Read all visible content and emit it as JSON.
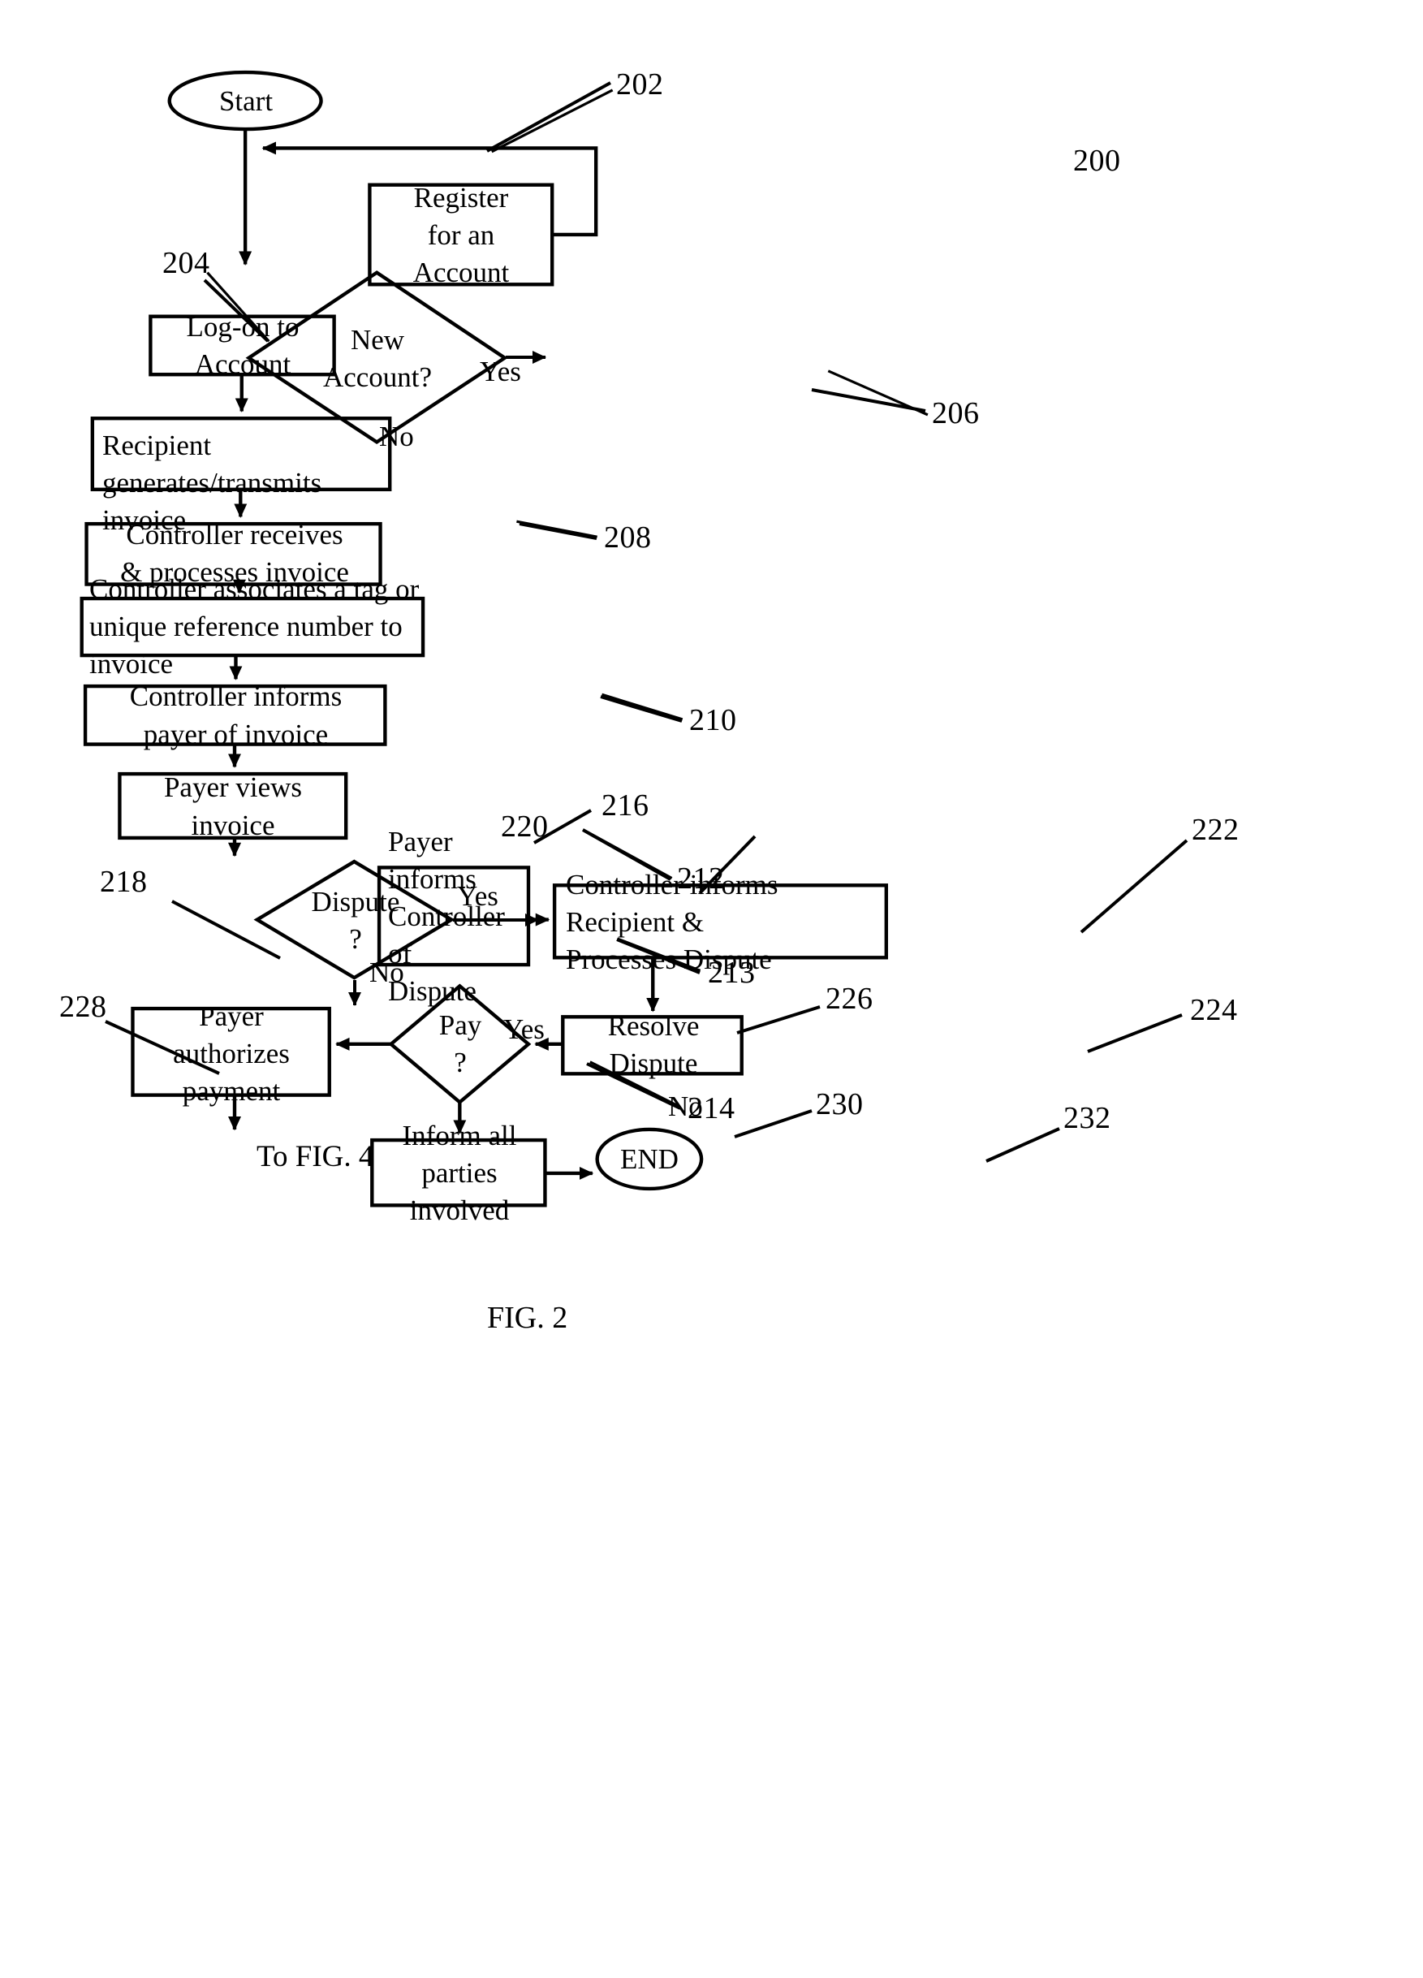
{
  "figure": {
    "caption": "FIG. 2",
    "diagram_ref": "200",
    "title_note": "To FIG. 4"
  },
  "nodes": {
    "start": {
      "label": "Start",
      "ref": "202",
      "shape": "ellipse"
    },
    "new_account": {
      "label": "New\nAccount?",
      "ref": "204",
      "shape": "diamond"
    },
    "register": {
      "label": "Register\nfor an Account",
      "ref": "206",
      "shape": "process"
    },
    "logon": {
      "label": "Log-on to\nAccount",
      "ref": "208",
      "shape": "process"
    },
    "recipient_invoice": {
      "label": "Recipient generates/transmits\ninvoice",
      "ref": "210",
      "shape": "process"
    },
    "controller_receives": {
      "label": "Controller receives\n& processes invoice",
      "ref": "212",
      "shape": "process"
    },
    "controller_tag": {
      "label": "Controller associates a tag or\nunique reference number to invoice",
      "ref": "213",
      "shape": "process"
    },
    "controller_informs_payer": {
      "label": "Controller informs\npayer of invoice",
      "ref": "214",
      "shape": "process"
    },
    "payer_views": {
      "label": "Payer views\ninvoice",
      "ref": "216",
      "shape": "process"
    },
    "dispute": {
      "label": "Dispute\n?",
      "ref": "218",
      "shape": "diamond"
    },
    "payer_informs": {
      "label": "Payer informs\nController of\nDispute",
      "ref": "220",
      "shape": "process"
    },
    "controller_informs_recipient": {
      "label": "Controller informs Recipient &\nProcesses Dispute",
      "ref": "222",
      "shape": "process"
    },
    "resolve_dispute": {
      "label": "Resolve Dispute",
      "ref": "224",
      "shape": "process"
    },
    "pay": {
      "label": "Pay\n?",
      "ref": "226",
      "shape": "diamond"
    },
    "payer_authorizes": {
      "label": "Payer authorizes\npayment",
      "ref": "228",
      "shape": "process"
    },
    "inform_parties": {
      "label": "Inform all parties\ninvolved",
      "ref": "230",
      "shape": "process"
    },
    "end": {
      "label": "END",
      "ref": "232",
      "shape": "ellipse"
    }
  },
  "edge_labels": {
    "new_account_yes": "Yes",
    "new_account_no": "No",
    "dispute_yes": "Yes",
    "dispute_no": "No",
    "pay_yes": "Yes",
    "pay_no": "No"
  },
  "colors": {
    "stroke": "#000000",
    "background": "#ffffff"
  }
}
